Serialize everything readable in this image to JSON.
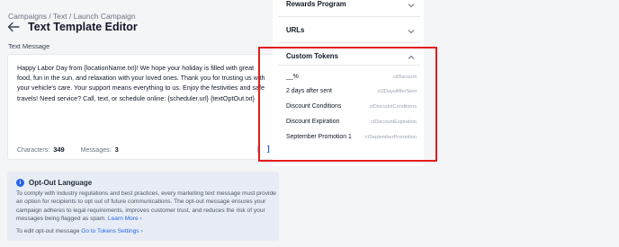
{
  "breadcrumb": "Campaigns / Text / Launch Campaign",
  "page_title": "Text Template Editor",
  "message_section_label": "Text Message",
  "message_text": "Happy Labor Day from {locationName.txt}! We hope your holiday is filled with great food, fun in the sun, and relaxation with your loved ones. Thank you for trusting us with your vehicle's care. Your support means everything to us. Enjoy the festivities and safe travels! Need service? Call, text, or schedule online: {scheduler.url} {textOptOut.txt}",
  "counts": {
    "characters_label": "Characters:",
    "characters_value": "349",
    "messages_label": "Messages:",
    "messages_value": "3"
  },
  "token_button": "[ ]",
  "optout": {
    "title": "Opt-Out Language",
    "body": "To comply with industry regulations and best practices, every marketing text message must provide an option for recipients to opt out of future communications. The opt-out message ensures your campaign adheres to legal requirements, improves customer trust, and reduces the risk of your messages being flagged as spam.",
    "learn_more": "Learn More ›",
    "footer_prefix": "To edit opt-out message",
    "footer_link": "Go to Tokens Settings ›"
  },
  "accordions": {
    "rewards": "Rewards Program",
    "urls": "URLs",
    "custom_tokens": "Custom Tokens"
  },
  "tokens": [
    {
      "label": "__%",
      "code": "ctDiscount"
    },
    {
      "label": "2 days after sent",
      "code": "ct2DaysAfterSent"
    },
    {
      "label": "Discount Conditions",
      "code": "ctDiscountConditions"
    },
    {
      "label": "Discount Expiration",
      "code": "ctDiscountExpiration"
    },
    {
      "label": "September Promotion 1",
      "code": "ctSeptemberPromotion"
    }
  ],
  "colors": {
    "accent": "#2563eb",
    "highlight": "#e11d1d"
  }
}
